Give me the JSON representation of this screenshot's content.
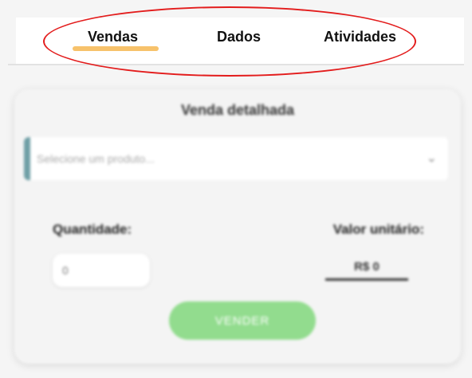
{
  "tabs": {
    "vendas": "Vendas",
    "dados": "Dados",
    "atividades": "Atividades"
  },
  "colors": {
    "tab_underline": "#f7c26b",
    "highlight_ring": "#e31c1c",
    "select_accent": "#6f9fa6",
    "sell_button": "#92dc8e"
  },
  "sale_form": {
    "title": "Venda detalhada",
    "product_select": {
      "placeholder": "Selecione um produto...",
      "chevron_icon": "chevron-down-icon"
    },
    "quantity": {
      "label": "Quantidade:",
      "value": "0"
    },
    "unit_value": {
      "label": "Valor unitário:",
      "value": "R$ 0"
    },
    "sell_button_label": "VENDER"
  }
}
